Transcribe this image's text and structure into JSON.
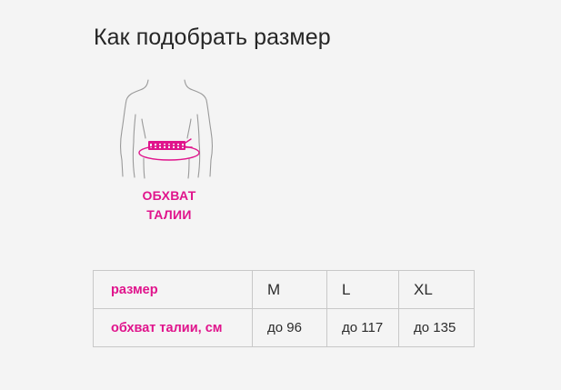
{
  "page": {
    "title": "Как подобрать размер"
  },
  "figure": {
    "icon": "waist-measurement-icon",
    "caption_line1": "ОБХВАТ",
    "caption_line2": "ТАЛИИ"
  },
  "table": {
    "rows": [
      {
        "label": "размер",
        "values": [
          "M",
          "L",
          "XL"
        ]
      },
      {
        "label": "обхват талии, см",
        "values": [
          "до 96",
          "до 117",
          "до 135"
        ]
      }
    ]
  },
  "colors": {
    "accent": "#e0148c",
    "text": "#262626",
    "background": "#f4f4f4",
    "border": "#c8c8c8",
    "outline": "#9a9a9a"
  }
}
